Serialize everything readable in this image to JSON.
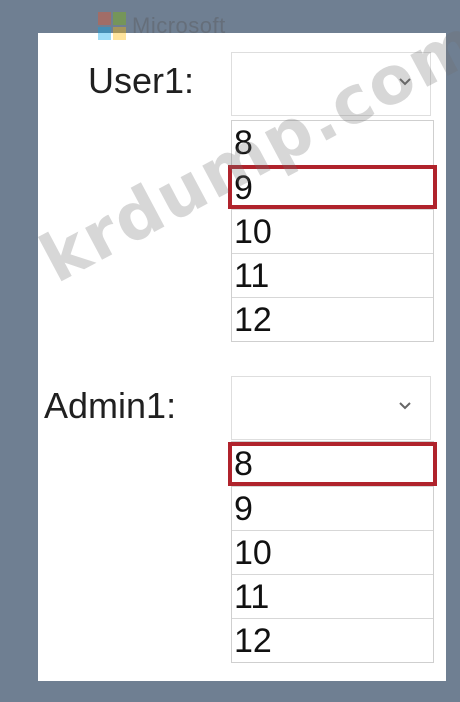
{
  "header": {
    "logo_text": "Microsoft"
  },
  "fields": [
    {
      "label": "User1:",
      "dropdown_value": "",
      "options": [
        "8",
        "9",
        "10",
        "11",
        "12"
      ],
      "selected": "9"
    },
    {
      "label": "Admin1:",
      "dropdown_value": "",
      "options": [
        "8",
        "9",
        "10",
        "11",
        "12"
      ],
      "selected": "8"
    }
  ],
  "watermark": {
    "text": "krdump.com"
  },
  "colors": {
    "background": "#6f7f92",
    "panel": "#ffffff",
    "selection_border": "#b0232c"
  },
  "icons": {
    "microsoft_logo": "microsoft-logo-icon",
    "dropdown_chevron": "chevron-down-icon"
  }
}
